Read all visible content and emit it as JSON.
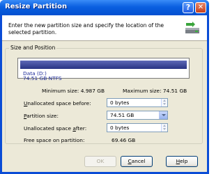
{
  "window": {
    "title": "Resize Partition",
    "help_button": "?",
    "close_button": "✕"
  },
  "header": {
    "description": "Enter the new partition size and specify the location of the selected partition.",
    "icon": "partition-resize-icon"
  },
  "group": {
    "label": "Size and Position"
  },
  "disk_map": {
    "partition_name": "Data (D:)",
    "partition_details": "74.51 GB  NTFS"
  },
  "size_info": {
    "minimum": "Minimum size: 4.987 GB",
    "maximum": "Maximum size: 74.51 GB"
  },
  "fields": {
    "unallocated_before": {
      "label_u": "U",
      "label_rest": "nallocated space before:",
      "value": "0 bytes"
    },
    "partition_size": {
      "label_u": "P",
      "label_rest": "artition size:",
      "value": "74.51 GB"
    },
    "unallocated_after": {
      "label_pre": "Unallocated space ",
      "label_u": "a",
      "label_rest": "fter:",
      "value": "0 bytes"
    },
    "free_space": {
      "label": "Free space on partition:",
      "value": "69.46 GB"
    }
  },
  "buttons": {
    "ok": "OK",
    "cancel_u": "C",
    "cancel_rest": "ancel",
    "help_u": "H",
    "help_rest": "elp"
  },
  "colors": {
    "titlebar": "#0a5fe0",
    "partition_bar": "#283383",
    "partition_text": "#1e2c9a",
    "dialog_bg": "#ece9d8"
  }
}
